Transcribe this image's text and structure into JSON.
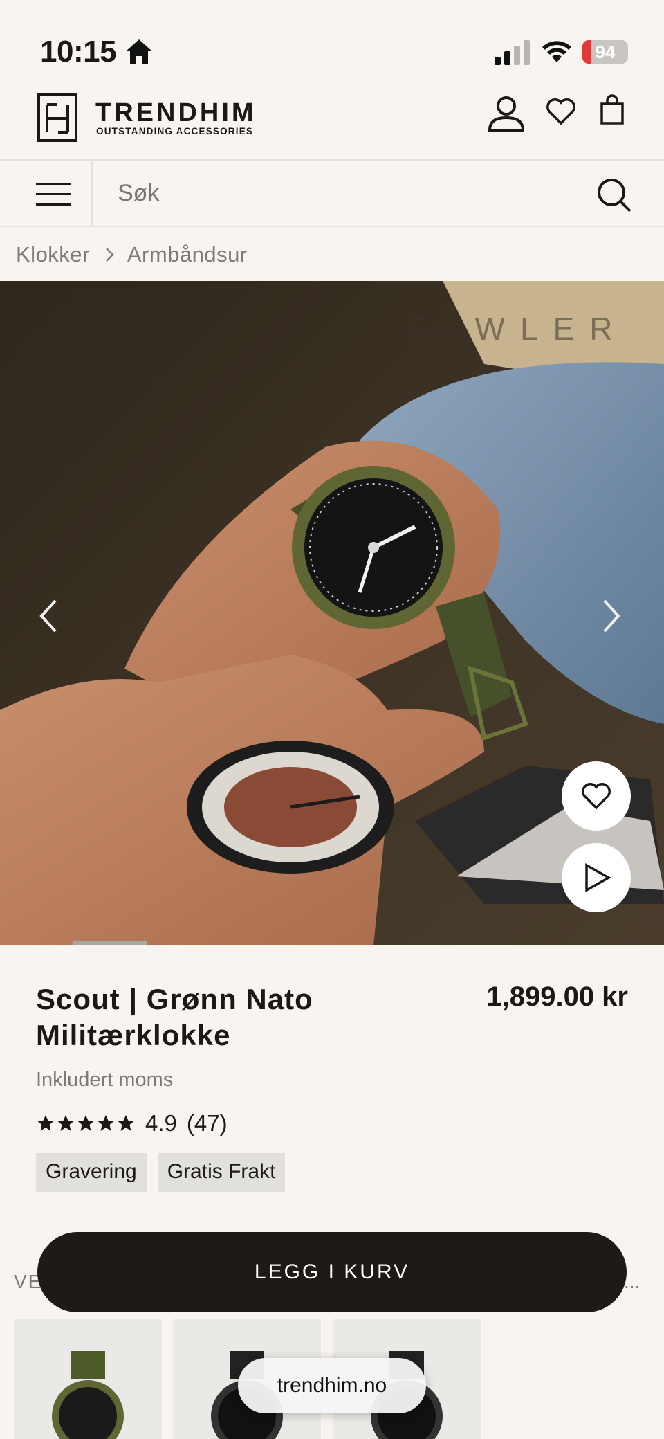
{
  "status_bar": {
    "time": "10:15",
    "battery_level": "94"
  },
  "header": {
    "brand_name": "TRENDHIM",
    "brand_tagline": "OUTSTANDING ACCESSORIES"
  },
  "search": {
    "placeholder": "Søk"
  },
  "breadcrumb": {
    "items": [
      "Klokker",
      "Armbåndsur"
    ]
  },
  "hero": {
    "brand_watermark": "FAWLER",
    "gallery_position": 0.22
  },
  "product": {
    "title": "Scout | Grønn Nato Militærklokke",
    "price": "1,899.00 kr",
    "vat_note": "Inkludert moms",
    "rating_value": "4.9",
    "rating_count": "(47)",
    "stars": 5,
    "badges": [
      "Gravering",
      "Gratis Frakt"
    ]
  },
  "cart": {
    "button_label": "LEGG I KURV"
  },
  "variants": {
    "label": "VE",
    "more": "..."
  },
  "browser": {
    "url": "trendhim.no"
  },
  "colors": {
    "background": "#f8f5f0",
    "primary": "#1e1a15",
    "battery_low": "#e23a36"
  }
}
